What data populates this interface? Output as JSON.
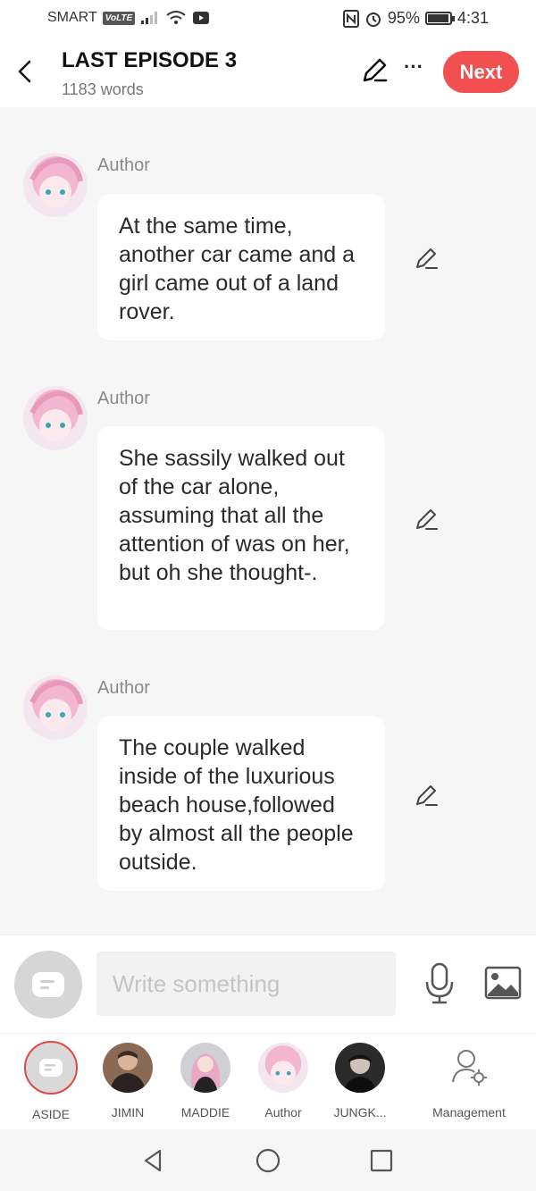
{
  "status_bar": {
    "carrier": "SMART",
    "volte": "VoLTE",
    "battery_percent": "95%",
    "battery_level": 0.95,
    "time": "4:31"
  },
  "header": {
    "title": "LAST EPISODE 3",
    "word_count": "1183 words",
    "more_label": "···",
    "next_label": "Next"
  },
  "messages": [
    {
      "author": "Author",
      "text": "At the same time, another car came and a girl came out of a land rover."
    },
    {
      "author": "Author",
      "text": "She sassily walked out of the car alone, assuming that all the attention of was on her, but oh she thought-."
    },
    {
      "author": "Author",
      "text": "The couple walked inside of the luxurious beach house,followed by almost all the people outside."
    }
  ],
  "composer": {
    "placeholder": "Write something"
  },
  "characters": [
    {
      "label": "ASIDE",
      "selected": true
    },
    {
      "label": "JIMIN"
    },
    {
      "label": "MADDIE"
    },
    {
      "label": "Author"
    },
    {
      "label": "JUNGK..."
    },
    {
      "label": "Management"
    }
  ],
  "colors": {
    "accent": "#f25050",
    "background": "#f6f6f6",
    "bubble": "#ffffff",
    "muted_text": "#8a8a8a"
  }
}
